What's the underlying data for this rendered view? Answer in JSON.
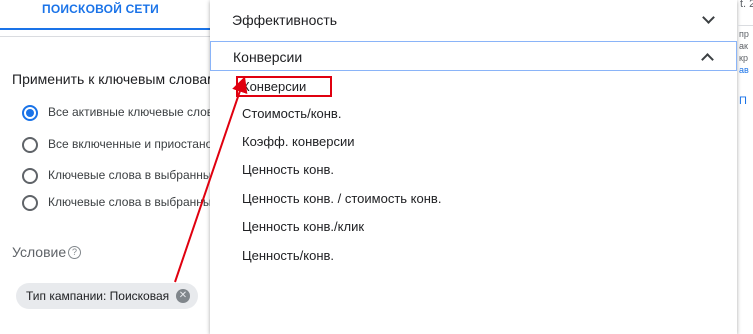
{
  "tab": {
    "label": "ПОИСКОВОЙ СЕТИ"
  },
  "rule": {
    "apply_heading": "Применить к ключевым словам",
    "options": [
      {
        "label": "Все активные ключевые слова",
        "selected": true
      },
      {
        "label": "Все включенные и приостановленные",
        "selected": false
      },
      {
        "label": "Ключевые слова в выбранных",
        "selected": false
      },
      {
        "label": "Ключевые слова в выбранных",
        "selected": false
      }
    ],
    "condition_label": "Условие",
    "help_icon": "help-circle-icon",
    "filter_chip": "Тип кампании: Поисковая"
  },
  "dropdown": {
    "group_collapsed": "Эффективность",
    "group_expanded": "Конверсии",
    "items": [
      "Конверсии",
      "Стоимость/конв.",
      "Коэфф. конверсии",
      "Ценность конв.",
      "Ценность конв. / стоимость конв.",
      "Ценность конв./клик",
      "Ценность/конв."
    ],
    "highlighted_item": "Конверсии"
  },
  "side_panel": {
    "corner_text": "t. 2",
    "lines": [
      "пр",
      "ак",
      "кр",
      "ав"
    ],
    "link": "П"
  },
  "colors": {
    "accent": "#1a73e8",
    "annotation": "#e0000f"
  }
}
